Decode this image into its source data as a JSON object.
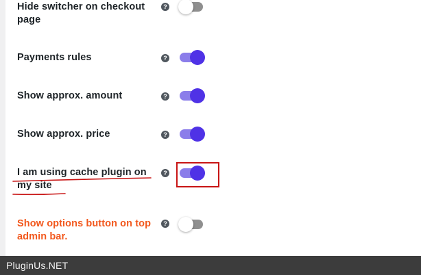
{
  "settings": [
    {
      "label": "Hide switcher on checkout page",
      "help": "?",
      "enabled": false,
      "label_color": "#1d2327"
    },
    {
      "label": "Payments rules",
      "help": "?",
      "enabled": true,
      "label_color": "#1d2327"
    },
    {
      "label": "Show approx. amount",
      "help": "?",
      "enabled": true,
      "label_color": "#1d2327"
    },
    {
      "label": "Show approx. price",
      "help": "?",
      "enabled": true,
      "label_color": "#1d2327"
    },
    {
      "label": "I am using cache plugin on my site",
      "help": "?",
      "enabled": true,
      "label_color": "#1d2327"
    },
    {
      "label": "Show options button on top admin bar.",
      "help": "?",
      "enabled": false,
      "label_color": "#f2581d"
    }
  ],
  "colors": {
    "toggle_on_knob": "#4f32e6",
    "toggle_on_track": "#8b7dea",
    "toggle_off_track": "#8f8f8f",
    "highlight_red": "#c81414",
    "accent_orange": "#f2581d"
  },
  "footer": {
    "watermark": "PluginUs.NET"
  }
}
